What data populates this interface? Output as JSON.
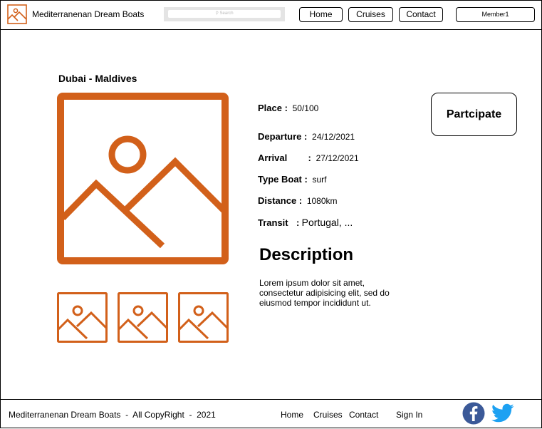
{
  "header": {
    "brand": "Mediterranenan Dream Boats",
    "search": {
      "placeholder": "Search"
    },
    "nav": {
      "home": "Home",
      "cruises": "Cruises",
      "contact": "Contact"
    },
    "member": "Member1"
  },
  "trip": {
    "title": "Dubai - Maldives",
    "details": [
      {
        "label": "Place :",
        "value": "50/100"
      },
      {
        "label": "Departure :",
        "value": "24/12/2021"
      },
      {
        "label": "Arrival",
        "sep": ":",
        "value": "27/12/2021"
      },
      {
        "label": "Type Boat :",
        "value": "surf"
      },
      {
        "label": "Distance :",
        "value": "1080km"
      },
      {
        "label": "Transit",
        "sep": ":",
        "value": "Portugal, ..."
      }
    ],
    "participate": "Partcipate",
    "description_title": "Description",
    "description": "Lorem ipsum dolor sit amet, consectetur adipisicing elit, sed do eiusmod tempor incididunt ut."
  },
  "footer": {
    "copyright": "Mediterranenan Dream Boats  -  All CopyRight  -  2021",
    "links": {
      "home": "Home",
      "cruises": "Cruises",
      "contact": "Contact",
      "signin": "Sign In"
    }
  },
  "colors": {
    "accent": "#D2601A",
    "facebook": "#3B5998",
    "twitter": "#1DA1F2"
  },
  "icons": {
    "logo": "image-placeholder-icon",
    "facebook": "facebook-icon",
    "twitter": "twitter-icon"
  }
}
